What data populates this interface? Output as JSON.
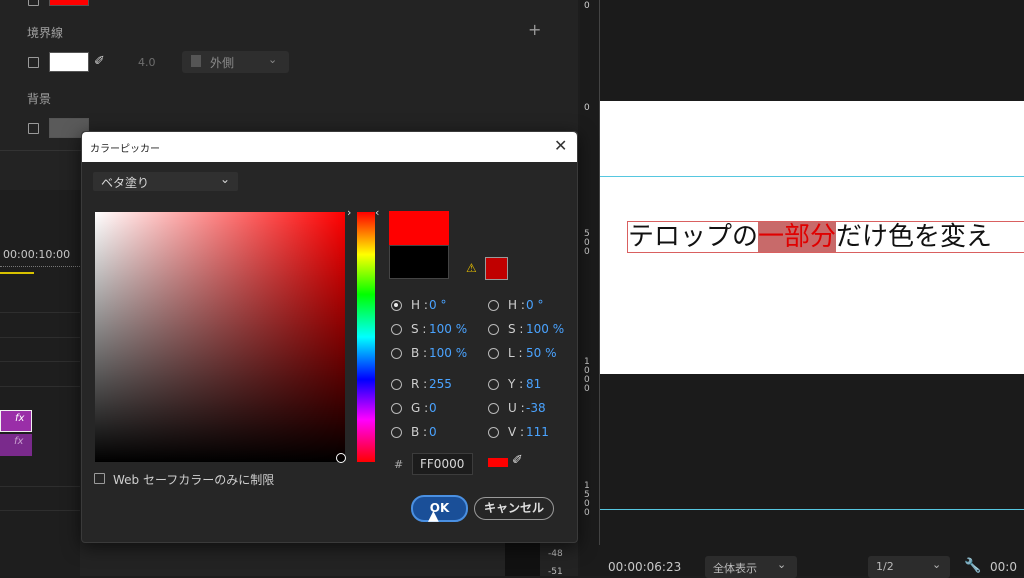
{
  "left_panel": {
    "border_label": "境界線",
    "border_width": "4.0",
    "border_position": "外側",
    "background_label": "背景",
    "add_symbol": "+",
    "timecode": "00:00:10:00",
    "fx_label": "fx"
  },
  "dialog": {
    "title": "カラーピッカー",
    "fill_type": "ベタ塗り",
    "web_safe_label": "Web セーフカラーのみに制限",
    "hash": "#",
    "hex_value": "FF0000",
    "ok_label": "OK",
    "cancel_label": "キャンセル",
    "hsb": [
      {
        "label": "H :",
        "value": "0 °"
      },
      {
        "label": "S :",
        "value": "100 %"
      },
      {
        "label": "B :",
        "value": "100 %"
      }
    ],
    "rgb": [
      {
        "label": "R :",
        "value": "255"
      },
      {
        "label": "G :",
        "value": "0"
      },
      {
        "label": "B :",
        "value": "0"
      }
    ],
    "hsl": [
      {
        "label": "H :",
        "value": "0 °"
      },
      {
        "label": "S :",
        "value": "100 %"
      },
      {
        "label": "L :",
        "value": "50 %"
      }
    ],
    "yuv": [
      {
        "label": "Y :",
        "value": "81"
      },
      {
        "label": "U :",
        "value": "-38"
      },
      {
        "label": "V :",
        "value": "111"
      }
    ],
    "colors": {
      "new_color": "#ff0000",
      "old_color": "#000000",
      "warning_color": "#c00000"
    }
  },
  "monitor": {
    "caption_pre": "テロップの",
    "caption_highlight": "一部分",
    "caption_post": "だけ色を変え",
    "timecode": "00:00:06:23",
    "fit_label": "全体表示",
    "resolution": "1/2",
    "timecode_right": "00:0",
    "audio_db_1": "-48",
    "audio_db_2": "-51",
    "ruler_marks": [
      "0",
      "0",
      "5\n0\n0",
      "1\n0\n0\n0",
      "1\n5\n0\n0"
    ]
  }
}
